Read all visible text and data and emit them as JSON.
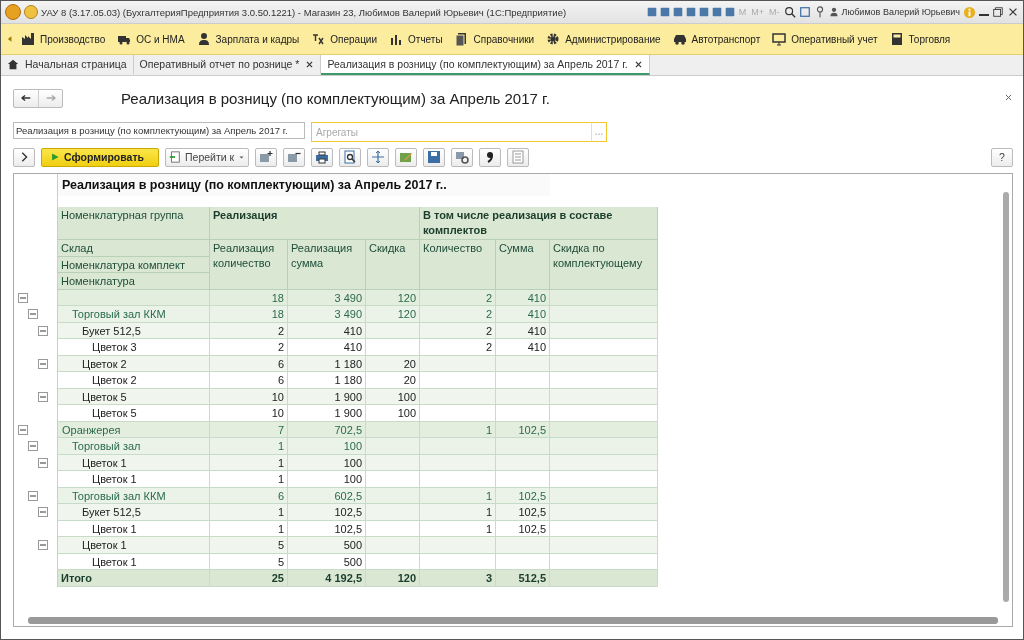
{
  "window": {
    "title": "УАУ 8 (3.17.05.03) (БухгалтерияПредприятия 3.0.50.1221) - Магазин 23, Любимов Валерий Юрьевич  (1С:Предприятие)",
    "memory_buttons": [
      "M",
      "M+",
      "M-"
    ],
    "user": "Любимов Валерий Юрьевич"
  },
  "sections": [
    {
      "label": "Производство"
    },
    {
      "label": "ОС и НМА"
    },
    {
      "label": "Зарплата и кадры"
    },
    {
      "label": "Операции"
    },
    {
      "label": "Отчеты"
    },
    {
      "label": "Справочники"
    },
    {
      "label": "Администрирование"
    },
    {
      "label": "Автотранспорт"
    },
    {
      "label": "Оперативный учет"
    },
    {
      "label": "Торговля"
    }
  ],
  "tabs": [
    {
      "label": "Начальная страница",
      "selected": false,
      "closable": false
    },
    {
      "label": "Оперативный отчет по рознице *",
      "selected": false,
      "closable": true
    },
    {
      "label": "Реализация в розницу (по комплектующим) за Апрель 2017 г.",
      "selected": true,
      "closable": true
    }
  ],
  "form": {
    "title": "Реализация в розницу (по комплектующим) за Апрель 2017 г.",
    "report_name": "Реализация в розницу (по комплектующим) за Апрель 2017 г.",
    "aggregates": {
      "placeholder": "Агрегаты"
    },
    "generate_button": "Сформировать",
    "goto_button": "Перейти к",
    "help_button": "?"
  },
  "report": {
    "heading": "Реализация в розницу (по комплектующим) за Апрель 2017 г..",
    "group_headers": [
      "Номенклатурная группа",
      "Склад",
      "Номенклатура комплект",
      "Номенклатура"
    ],
    "column_groups": [
      {
        "label": "Реализация",
        "columns": [
          "Реализация количество",
          "Реализация сумма",
          "Скидка"
        ]
      },
      {
        "label": "В том числе реализация в составе комплектов",
        "columns": [
          "Количество",
          "Сумма",
          "Скидка по комплектующему"
        ]
      }
    ],
    "rows": [
      {
        "values": {
          "qty": "18",
          "sum": "3 490",
          "discount": "120",
          "kit_qty": "2",
          "kit_sum": "410"
        },
        "expanded": true,
        "children": [
          {
            "name": "Торговый зал ККМ",
            "values": {
              "qty": "18",
              "sum": "3 490",
              "discount": "120",
              "kit_qty": "2",
              "kit_sum": "410"
            },
            "expanded": true,
            "children": [
              {
                "name": "Букет 512,5",
                "values": {
                  "qty": "2",
                  "sum": "410",
                  "kit_qty": "2",
                  "kit_sum": "410"
                },
                "expanded": true,
                "children": [
                  {
                    "name": "Цветок 3",
                    "values": {
                      "qty": "2",
                      "sum": "410",
                      "kit_qty": "2",
                      "kit_sum": "410"
                    }
                  }
                ]
              },
              {
                "name": "Цветок 2",
                "values": {
                  "qty": "6",
                  "sum": "1 180",
                  "discount": "20"
                },
                "expanded": true,
                "children": [
                  {
                    "name": "Цветок 2",
                    "values": {
                      "qty": "6",
                      "sum": "1 180",
                      "discount": "20"
                    }
                  }
                ]
              },
              {
                "name": "Цветок 5",
                "values": {
                  "qty": "10",
                  "sum": "1 900",
                  "discount": "100"
                },
                "expanded": true,
                "children": [
                  {
                    "name": "Цветок 5",
                    "values": {
                      "qty": "10",
                      "sum": "1 900",
                      "discount": "100"
                    }
                  }
                ]
              }
            ]
          }
        ]
      },
      {
        "name": "Оранжерея",
        "values": {
          "qty": "7",
          "sum": "702,5",
          "kit_qty": "1",
          "kit_sum": "102,5"
        },
        "expanded": true,
        "children": [
          {
            "name": "Торговый зал",
            "values": {
              "qty": "1",
              "sum": "100"
            },
            "expanded": true,
            "children": [
              {
                "name": "Цветок 1",
                "values": {
                  "qty": "1",
                  "sum": "100"
                },
                "expanded": true,
                "children": [
                  {
                    "name": "Цветок 1",
                    "values": {
                      "qty": "1",
                      "sum": "100"
                    }
                  }
                ]
              }
            ]
          },
          {
            "name": "Торговый зал ККМ",
            "values": {
              "qty": "6",
              "sum": "602,5",
              "kit_qty": "1",
              "kit_sum": "102,5"
            },
            "expanded": true,
            "children": [
              {
                "name": "Букет 512,5",
                "values": {
                  "qty": "1",
                  "sum": "102,5",
                  "kit_qty": "1",
                  "kit_sum": "102,5"
                },
                "expanded": true,
                "children": [
                  {
                    "name": "Цветок 1",
                    "values": {
                      "qty": "1",
                      "sum": "102,5",
                      "kit_qty": "1",
                      "kit_sum": "102,5"
                    }
                  }
                ]
              },
              {
                "name": "Цветок 1",
                "values": {
                  "qty": "5",
                  "sum": "500"
                },
                "expanded": true,
                "children": [
                  {
                    "name": "Цветок 1",
                    "values": {
                      "qty": "5",
                      "sum": "500"
                    }
                  }
                ]
              }
            ]
          }
        ]
      }
    ],
    "total": {
      "label": "Итого",
      "values": {
        "qty": "25",
        "sum": "4 192,5",
        "discount": "120",
        "kit_qty": "3",
        "kit_sum": "512,5"
      }
    }
  }
}
